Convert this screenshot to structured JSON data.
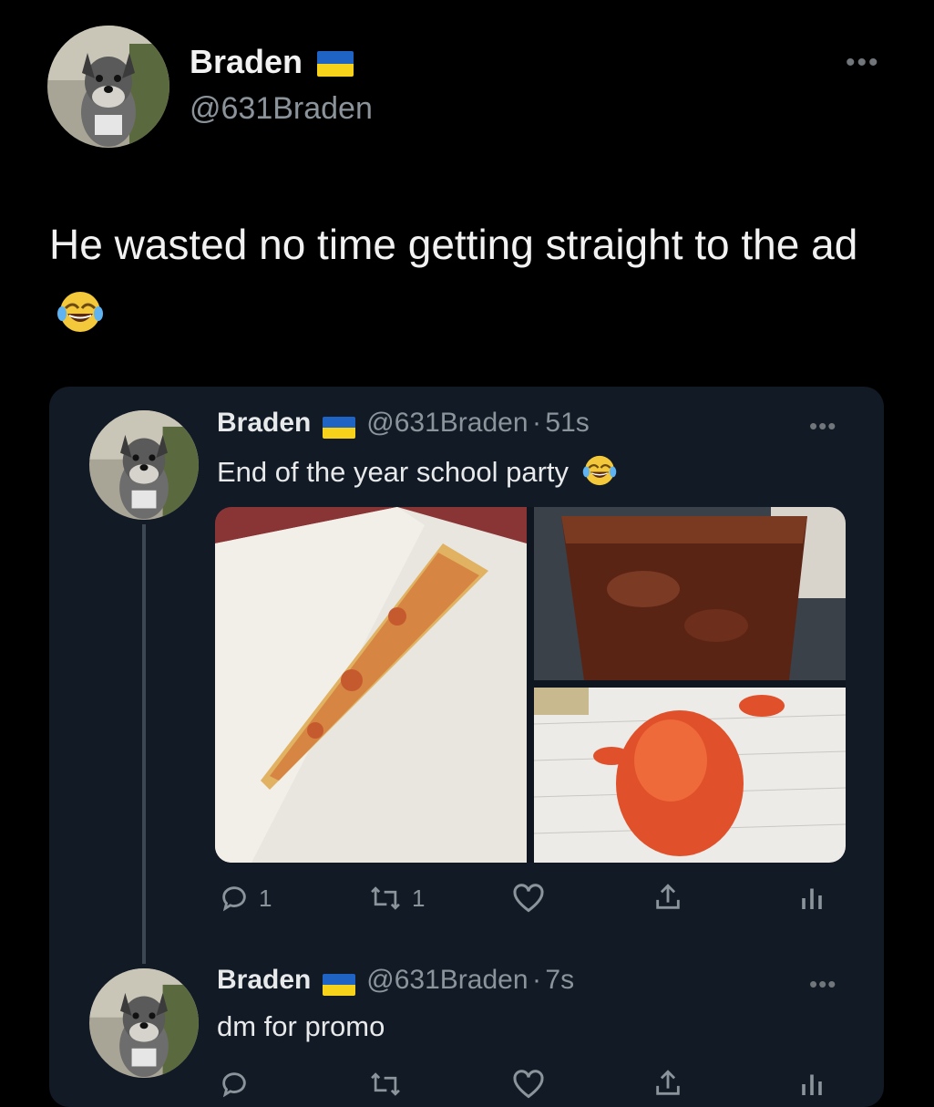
{
  "tweet": {
    "author_name": "Braden",
    "author_handle": "@631Braden",
    "text": "He wasted no time getting straight to the ad",
    "emoji": "face-with-tears-of-joy"
  },
  "quoted_thread": {
    "first": {
      "author_name": "Braden",
      "author_handle": "@631Braden",
      "separator": "·",
      "time": "51s",
      "text": "End of the year school party",
      "emoji": "face-with-tears-of-joy",
      "media": [
        "pizza-slice-photo",
        "soda-cup-photo",
        "cheetos-photo"
      ],
      "actions": {
        "reply_count": "1",
        "retweet_count": "1"
      }
    },
    "second": {
      "author_name": "Braden",
      "author_handle": "@631Braden",
      "separator": "·",
      "time": "7s",
      "text": "dm for promo"
    }
  },
  "icons": {
    "more": "more-horizontal-icon",
    "flag": "ukraine-flag-icon",
    "reply": "reply-icon",
    "retweet": "retweet-icon",
    "like": "heart-icon",
    "share": "share-icon",
    "analytics": "analytics-icon"
  },
  "colors": {
    "background": "#000000",
    "card": "#121a26",
    "text": "#e7e9ea",
    "muted": "#8b939b",
    "flag_blue": "#1f63c4",
    "flag_yellow": "#f6d21b"
  }
}
